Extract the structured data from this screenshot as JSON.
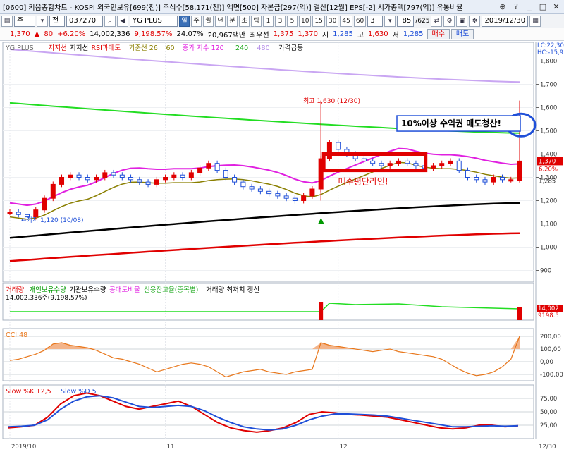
{
  "window": {
    "title": "[0600] 키움종합차트 - KOSPI 외국인보유[699(천)] 주식수[58,171(천)] 액면[500] 자본금[297(억)] 결산[12월] EPS[-2] 시가총액[797(억)] 유통비율"
  },
  "toolbar": {
    "market": "주",
    "type": "전",
    "code": "037270",
    "name": "YG PLUS",
    "periods": [
      "일",
      "주",
      "월",
      "년",
      "분",
      "초",
      "틱"
    ],
    "active_period": "일",
    "intervals": [
      "1",
      "3",
      "5",
      "10",
      "15",
      "30",
      "45",
      "60"
    ],
    "interval_value": "3",
    "count": "85",
    "count_total": "/625",
    "date": "2019/12/30"
  },
  "quote": {
    "price": "1,370",
    "change": "80",
    "rate": "+6.20%",
    "volume": "14,002,336",
    "volume_ratio": "9,198.57%",
    "turnover": "24.07%",
    "amount": "20,967백만",
    "pref_label": "최우선",
    "pref_ask": "1,375",
    "pref_bid": "1,370",
    "open_label": "시",
    "open": "1,285",
    "high_label": "고",
    "high": "1,630",
    "low_label": "저",
    "low": "1,285",
    "buy_label": "매수",
    "sell_label": "매도"
  },
  "main_legend": {
    "name": "YG PLUS",
    "support": "지지선",
    "resist": "지지선",
    "rsi": "RSI과매도",
    "base": "기준선 26",
    "base_b": "60",
    "vol_idx": "증가 지수 120",
    "vol_b": "240",
    "vol_c": "480",
    "surge": "가격급등"
  },
  "annotations": {
    "high": "최고 1,630 (12/30)",
    "low": "←최저 1,120 (10/08)",
    "target": "10%이상 수익권 매도청산!",
    "entry": "매수평단라인!",
    "lc": "LC:22,30",
    "hc": "HC:-15,9"
  },
  "price_axis": {
    "ticks": [
      "1,800",
      "1,700",
      "1,600",
      "1,500",
      "1,400",
      "1,300",
      "1,200",
      "1,100",
      "1,000",
      "900"
    ],
    "current": "1,370",
    "current_rate": "6.20%",
    "current_low": "1,285"
  },
  "vol_panel": {
    "legend": [
      "거래량",
      "개인보유수량",
      "기관보유수량",
      "공매도비율",
      "신용잔고율(종목별)",
      "거래량 최저치 갱신"
    ],
    "value_line": "14,002,336주(9,198.57%)",
    "axis_a": "14,002",
    "axis_b": "9198.5"
  },
  "cci_panel": {
    "legend": "CCI 48",
    "ticks": [
      "200,00",
      "100,00",
      "0,00",
      "-100,00"
    ]
  },
  "slow_panel": {
    "legend_k": "Slow %K 12,5",
    "legend_d": "Slow %D 5",
    "ticks": [
      "75,00",
      "50,00",
      "25,00"
    ]
  },
  "date_axis": {
    "labels": [
      "2019/10",
      "11",
      "12"
    ],
    "right": "12/30"
  },
  "colors": {
    "up": "#e00000",
    "down": "#1f4fd8",
    "ma_purple": "#c9a6f2",
    "ma_green": "#22dd22",
    "ma_magenta": "#e020e0",
    "ma_olive": "#8a7f00",
    "ma_black": "#000000",
    "ma_red": "#e00000"
  },
  "chart_data": {
    "type": "line",
    "series": [
      {
        "name": "YG PLUS",
        "x_days": 60,
        "values": [
          1150,
          1140,
          1130,
          1160,
          1210,
          1270,
          1300,
          1310,
          1300,
          1290,
          1300,
          1320,
          1310,
          1300,
          1290,
          1280,
          1270,
          1290,
          1300,
          1310,
          1300,
          1320,
          1340,
          1360,
          1330,
          1300,
          1280,
          1260,
          1250,
          1240,
          1230,
          1220,
          1210,
          1200,
          1220,
          1250,
          1380,
          1450,
          1420,
          1400,
          1380,
          1370,
          1360,
          1350,
          1360,
          1370,
          1360,
          1350,
          1340,
          1350,
          1360,
          1370,
          1330,
          1300,
          1290,
          1280,
          1300,
          1290,
          1290,
          1370
        ]
      }
    ],
    "ylim": [
      850,
      1850
    ],
    "ma_purple": [
      1850,
      1710
    ],
    "ma_green": [
      1620,
      1490
    ],
    "ma_black": [
      1040,
      1190
    ],
    "ma_red": [
      940,
      1060
    ],
    "cci_ylim": [
      -150,
      250
    ],
    "cci_values": [
      10,
      20,
      40,
      60,
      90,
      140,
      150,
      130,
      120,
      110,
      90,
      60,
      30,
      20,
      0,
      -20,
      -50,
      -80,
      -60,
      -40,
      -20,
      -10,
      -20,
      -40,
      -80,
      -120,
      -100,
      -80,
      -70,
      -60,
      -80,
      -90,
      -100,
      -80,
      -70,
      -60,
      150,
      130,
      120,
      110,
      100,
      90,
      80,
      90,
      100,
      80,
      70,
      60,
      50,
      40,
      20,
      -20,
      -60,
      -90,
      -110,
      -100,
      -80,
      -40,
      20,
      200
    ],
    "slow_k": [
      20,
      22,
      25,
      40,
      65,
      80,
      85,
      80,
      70,
      60,
      55,
      60,
      65,
      70,
      60,
      45,
      30,
      20,
      15,
      12,
      15,
      20,
      30,
      45,
      50,
      48,
      45,
      44,
      42,
      40,
      35,
      30,
      25,
      20,
      18,
      20,
      25,
      25,
      22,
      24
    ],
    "slow_d": [
      22,
      23,
      25,
      35,
      55,
      70,
      78,
      80,
      76,
      68,
      60,
      58,
      60,
      62,
      60,
      52,
      40,
      30,
      22,
      18,
      16,
      18,
      25,
      35,
      42,
      46,
      46,
      45,
      44,
      42,
      38,
      34,
      30,
      26,
      22,
      22,
      23,
      24,
      23,
      24
    ]
  }
}
